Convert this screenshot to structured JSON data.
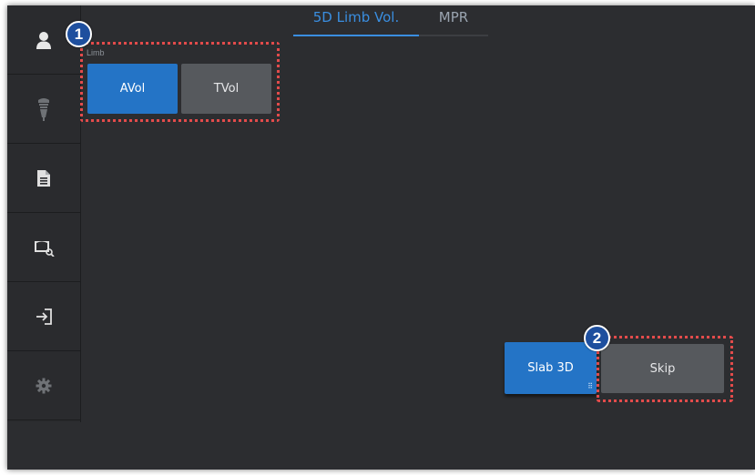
{
  "tabs": [
    {
      "label": "5D Limb Vol.",
      "active": true
    },
    {
      "label": "MPR",
      "active": false
    }
  ],
  "sidebar": {
    "items": [
      {
        "icon": "patient-icon",
        "active": true
      },
      {
        "icon": "probe-icon",
        "active": false
      },
      {
        "icon": "report-icon",
        "active": false
      },
      {
        "icon": "image-review-icon",
        "active": true
      },
      {
        "icon": "exit-icon",
        "active": true
      },
      {
        "icon": "settings-icon",
        "active": false
      }
    ]
  },
  "limb": {
    "label": "Limb",
    "buttons": [
      {
        "label": "AVol",
        "selected": true
      },
      {
        "label": "TVol",
        "selected": false
      }
    ]
  },
  "actions": {
    "slab_label": "Slab 3D",
    "skip_label": "Skip"
  },
  "callouts": [
    "1",
    "2"
  ],
  "colors": {
    "accent": "#2474c6",
    "tab_active": "#3a8ee0",
    "highlight": "#e24b4b"
  }
}
